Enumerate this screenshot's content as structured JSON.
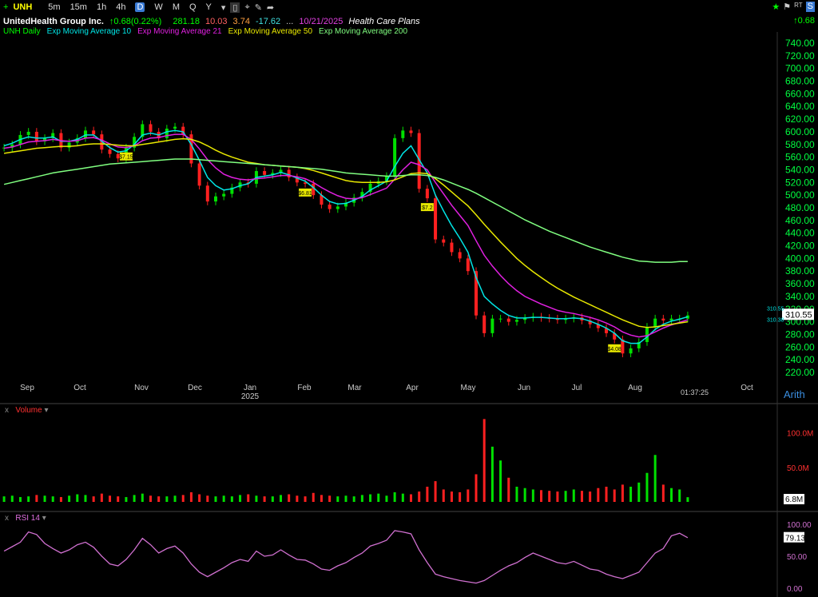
{
  "toolbar": {
    "symbol": "UNH",
    "timeframes": [
      "5m",
      "15m",
      "1h",
      "4h",
      "D",
      "W",
      "M",
      "Q",
      "Y"
    ],
    "active_timeframe": "D"
  },
  "header": {
    "company": "UnitedHealth Group Inc.",
    "change": "0.68(0.22%)",
    "open": "281.18",
    "high": "10.03",
    "low": "3.74",
    "close": "-17.62",
    "ellipsis": "...",
    "date": "10/21/2025",
    "industry": "Health Care Plans",
    "right_change": "0.68"
  },
  "indicators": {
    "daily": "UNH Daily",
    "ema10": "Exp Moving Average 10",
    "ema21": "Exp Moving Average 21",
    "ema50": "Exp Moving Average 50",
    "ema200": "Exp Moving Average 200"
  },
  "colors": {
    "up": "#00e000",
    "down": "#ff2020",
    "ema10": "#00e5e5",
    "ema21": "#e020e0",
    "ema50": "#e8e800",
    "ema200": "#80ff80",
    "axis": "#00ff40",
    "rsi": "#d070d0"
  },
  "chart_data": {
    "type": "line",
    "title": "UnitedHealth Group Inc.",
    "xlabel": "",
    "ylabel": "",
    "ylim": [
      220,
      740
    ],
    "scale": "Arith",
    "price_ticks": [
      "740.00",
      "720.00",
      "700.00",
      "680.00",
      "660.00",
      "640.00",
      "620.00",
      "600.00",
      "580.00",
      "560.00",
      "540.00",
      "520.00",
      "500.00",
      "480.00",
      "460.00",
      "440.00",
      "420.00",
      "400.00",
      "380.00",
      "360.00",
      "340.00",
      "320.00",
      "300.00",
      "280.00",
      "260.00",
      "240.00",
      "220.00"
    ],
    "month_labels": [
      "Sep",
      "Oct",
      "Nov",
      "Dec",
      "Jan",
      "Feb",
      "Mar",
      "Apr",
      "May",
      "Jun",
      "Jul",
      "Aug",
      "Oct"
    ],
    "year_label": "2025",
    "timer": "01:37:25",
    "last_price": "310.55",
    "price_tags": [
      "310.55",
      "310.38"
    ],
    "dividends": [
      "$7.15",
      "$6.81",
      "$7.2",
      "$4.08"
    ],
    "series": [
      {
        "name": "UNH Daily",
        "values": [
          575,
          580,
          595,
          600,
          585,
          590,
          598,
          575,
          583,
          590,
          602,
          596,
          572,
          565,
          558,
          575,
          592,
          612,
          600,
          590,
          605,
          608,
          596,
          550,
          515,
          490,
          498,
          502,
          512,
          520,
          518,
          538,
          532,
          535,
          540,
          528,
          520,
          518,
          500,
          485,
          478,
          482,
          488,
          496,
          505,
          518,
          522,
          530,
          590,
          602,
          598,
          510,
          495,
          430,
          425,
          410,
          400,
          380,
          310,
          282,
          305,
          305,
          300,
          303,
          306,
          308,
          306,
          305,
          303,
          305,
          307,
          302,
          296,
          290,
          282,
          272,
          250,
          258,
          268,
          292,
          305,
          302,
          305,
          305,
          310
        ]
      },
      {
        "name": "Exp Moving Average 10",
        "values": [
          578,
          582,
          588,
          592,
          590,
          590,
          592,
          585,
          585,
          588,
          595,
          595,
          585,
          575,
          568,
          570,
          580,
          595,
          598,
          595,
          600,
          602,
          600,
          580,
          555,
          528,
          515,
          508,
          510,
          515,
          518,
          528,
          530,
          532,
          536,
          532,
          527,
          522,
          512,
          500,
          490,
          486,
          487,
          492,
          498,
          508,
          515,
          522,
          545,
          566,
          578,
          556,
          535,
          500,
          475,
          452,
          432,
          410,
          370,
          340,
          328,
          318,
          310,
          306,
          306,
          307,
          307,
          306,
          305,
          305,
          306,
          305,
          301,
          296,
          290,
          282,
          270,
          266,
          266,
          276,
          288,
          296,
          301,
          304,
          308
        ]
      },
      {
        "name": "Exp Moving Average 21",
        "values": [
          574,
          576,
          580,
          584,
          585,
          586,
          588,
          586,
          585,
          586,
          590,
          591,
          587,
          581,
          576,
          575,
          578,
          586,
          590,
          591,
          594,
          596,
          596,
          588,
          573,
          556,
          543,
          533,
          528,
          525,
          524,
          526,
          527,
          529,
          531,
          531,
          529,
          526,
          520,
          512,
          505,
          499,
          495,
          494,
          496,
          501,
          506,
          511,
          525,
          540,
          552,
          548,
          540,
          520,
          502,
          484,
          468,
          452,
          428,
          405,
          388,
          373,
          360,
          349,
          340,
          334,
          328,
          323,
          318,
          315,
          313,
          310,
          307,
          303,
          298,
          292,
          284,
          279,
          276,
          278,
          284,
          290,
          295,
          299,
          303
        ]
      },
      {
        "name": "Exp Moving Average 50",
        "values": [
          566,
          568,
          570,
          572,
          574,
          575,
          576,
          577,
          577,
          578,
          580,
          581,
          581,
          580,
          579,
          578,
          578,
          580,
          582,
          584,
          586,
          588,
          589,
          588,
          584,
          578,
          571,
          565,
          560,
          556,
          552,
          550,
          548,
          547,
          546,
          545,
          544,
          542,
          539,
          535,
          531,
          527,
          523,
          521,
          520,
          520,
          520,
          521,
          524,
          529,
          534,
          535,
          534,
          526,
          516,
          505,
          494,
          483,
          469,
          454,
          440,
          426,
          413,
          400,
          389,
          379,
          370,
          361,
          353,
          346,
          339,
          333,
          327,
          321,
          315,
          309,
          303,
          298,
          293,
          291,
          292,
          294,
          296,
          298,
          300
        ]
      },
      {
        "name": "Exp Moving Average 200",
        "values": [
          517,
          520,
          523,
          526,
          529,
          532,
          535,
          537,
          539,
          541,
          543,
          545,
          547,
          549,
          550,
          551,
          552,
          553,
          554,
          555,
          556,
          557,
          557,
          557,
          556,
          555,
          554,
          553,
          552,
          551,
          550,
          549,
          548,
          547,
          546,
          545,
          544,
          543,
          542,
          541,
          539,
          537,
          535,
          534,
          533,
          532,
          531,
          530,
          530,
          531,
          532,
          532,
          531,
          528,
          524,
          519,
          514,
          509,
          503,
          496,
          489,
          482,
          475,
          468,
          461,
          455,
          449,
          443,
          438,
          433,
          428,
          423,
          418,
          414,
          410,
          406,
          402,
          399,
          396,
          395,
          394,
          394,
          394,
          395,
          395
        ]
      }
    ]
  },
  "volume": {
    "label": "Volume",
    "ticks": [
      "100.0M",
      "50.0M"
    ],
    "last": "6.8M",
    "values": [
      8,
      9,
      7,
      8,
      10,
      9,
      8,
      7,
      9,
      11,
      10,
      8,
      12,
      9,
      8,
      7,
      10,
      12,
      9,
      8,
      8,
      9,
      10,
      14,
      11,
      9,
      8,
      9,
      8,
      10,
      11,
      9,
      8,
      8,
      10,
      11,
      9,
      8,
      13,
      10,
      9,
      8,
      9,
      8,
      10,
      11,
      12,
      9,
      14,
      12,
      11,
      15,
      22,
      30,
      18,
      15,
      14,
      18,
      40,
      120,
      80,
      60,
      35,
      22,
      20,
      18,
      17,
      16,
      15,
      16,
      18,
      16,
      15,
      20,
      22,
      18,
      25,
      22,
      28,
      42,
      68,
      25,
      20,
      18,
      6.8
    ]
  },
  "rsi": {
    "label": "RSI 14",
    "ticks": [
      "100.00",
      "50.00",
      "0.00"
    ],
    "last": "79.13",
    "values": [
      58,
      65,
      72,
      88,
      84,
      70,
      62,
      55,
      60,
      68,
      72,
      64,
      50,
      38,
      35,
      45,
      60,
      78,
      68,
      55,
      62,
      66,
      55,
      38,
      25,
      18,
      25,
      32,
      40,
      45,
      42,
      58,
      50,
      52,
      60,
      52,
      45,
      44,
      38,
      30,
      28,
      35,
      40,
      48,
      55,
      66,
      70,
      75,
      90,
      88,
      85,
      60,
      40,
      22,
      18,
      15,
      12,
      10,
      8,
      12,
      20,
      28,
      35,
      40,
      48,
      55,
      50,
      45,
      40,
      38,
      42,
      36,
      30,
      28,
      22,
      18,
      15,
      20,
      25,
      40,
      55,
      62,
      82,
      86,
      79
    ]
  }
}
